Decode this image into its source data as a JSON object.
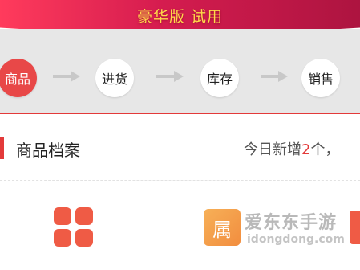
{
  "banner": {
    "title": "豪华版 试用"
  },
  "steps": [
    {
      "label": "商品",
      "active": true
    },
    {
      "label": "进货",
      "active": false
    },
    {
      "label": "库存",
      "active": false
    },
    {
      "label": "销售",
      "active": false
    }
  ],
  "section": {
    "title": "商品档案",
    "today_prefix": "今日新增",
    "today_count": "2",
    "today_suffix": "个，"
  },
  "watermark": {
    "badge_char": "属",
    "title": "爱东东手游",
    "url": "idongdong.com"
  },
  "colors": {
    "accent": "#e33a3a",
    "banner_text": "#ffd84a",
    "icon": "#ef5b45"
  }
}
